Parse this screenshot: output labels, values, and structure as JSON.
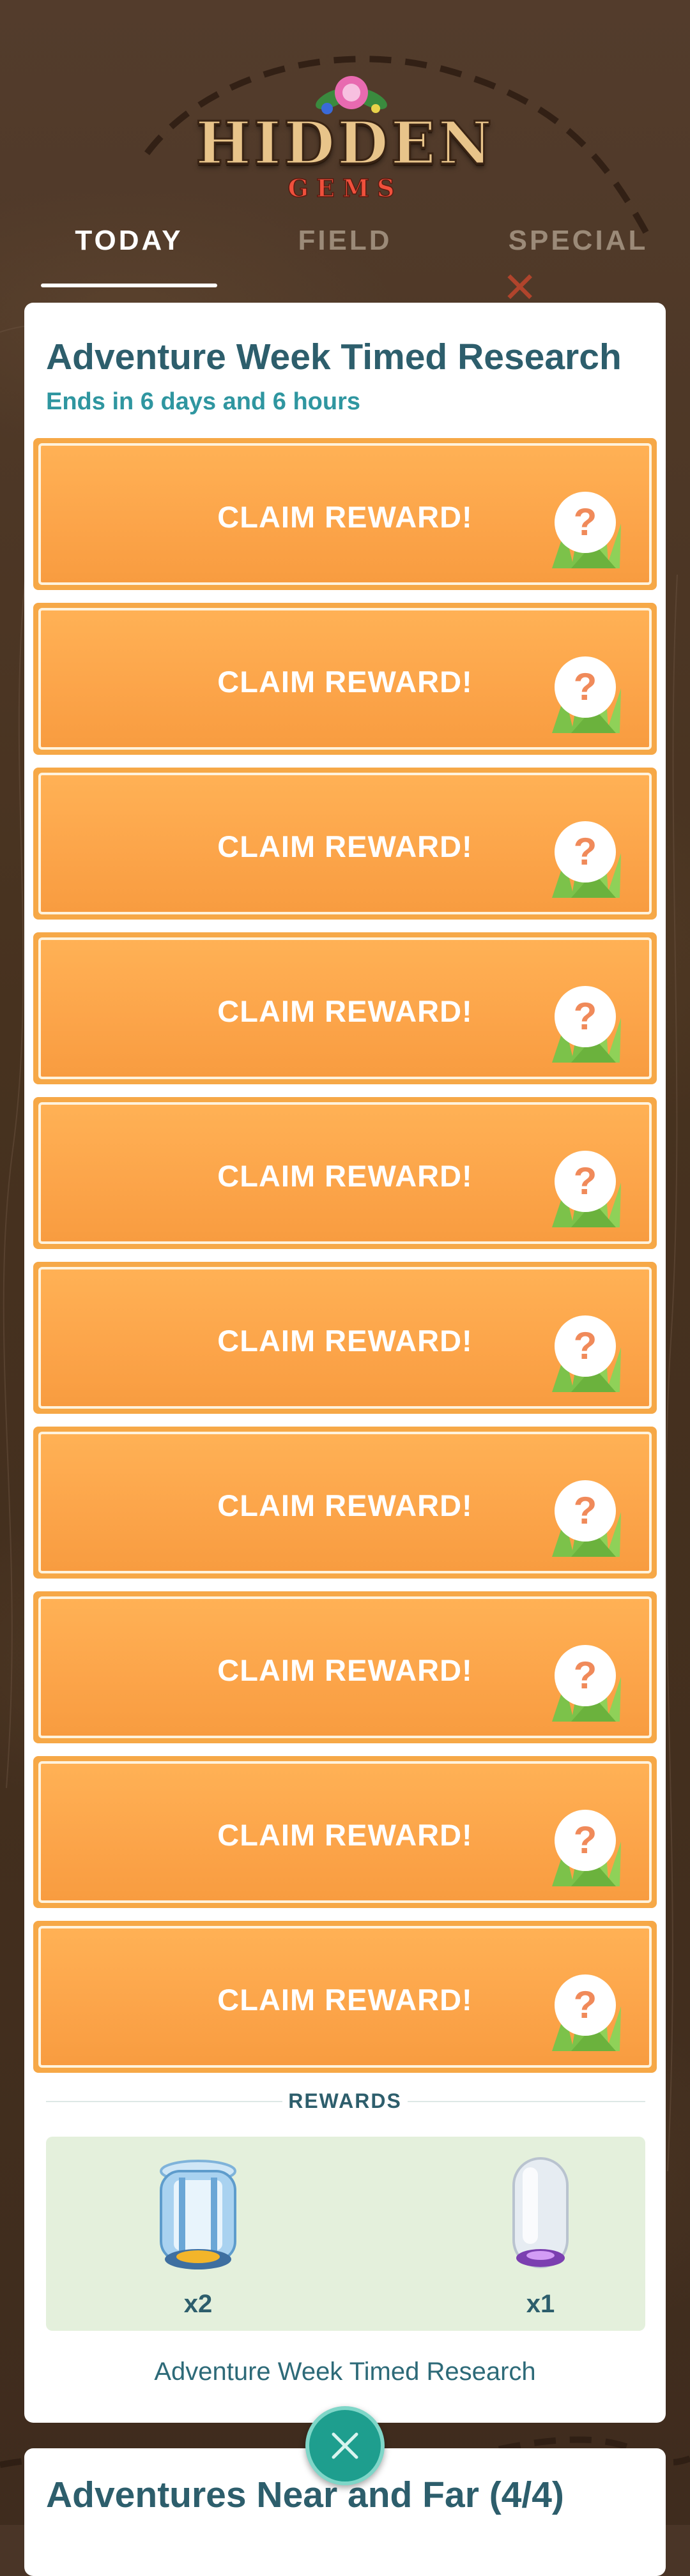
{
  "logo": {
    "word": "HIDDEN",
    "sub": "GEMS"
  },
  "tabs": [
    {
      "label": "TODAY",
      "active": true
    },
    {
      "label": "FIELD",
      "active": false
    },
    {
      "label": "SPECIAL",
      "active": false
    }
  ],
  "research": {
    "title": "Adventure Week Timed Research",
    "subtitle": "Ends in 6 days and 6 hours",
    "claims": [
      {
        "label": "CLAIM REWARD!"
      },
      {
        "label": "CLAIM REWARD!"
      },
      {
        "label": "CLAIM REWARD!"
      },
      {
        "label": "CLAIM REWARD!"
      },
      {
        "label": "CLAIM REWARD!"
      },
      {
        "label": "CLAIM REWARD!"
      },
      {
        "label": "CLAIM REWARD!"
      },
      {
        "label": "CLAIM REWARD!"
      },
      {
        "label": "CLAIM REWARD!"
      },
      {
        "label": "CLAIM REWARD!"
      }
    ],
    "rewards_heading": "REWARDS",
    "rewards": [
      {
        "icon": "super-incubator-icon",
        "qty": "x2"
      },
      {
        "icon": "incense-icon",
        "qty": "x1"
      }
    ],
    "footer": "Adventure Week Timed Research"
  },
  "next_card": {
    "title": "Adventures Near and Far (4/4)"
  },
  "colors": {
    "accent_teal": "#2d5e6c",
    "subtitle_teal": "#2f96a0",
    "claim_orange": "#fca54a",
    "close_button": "#1e9e8e"
  }
}
